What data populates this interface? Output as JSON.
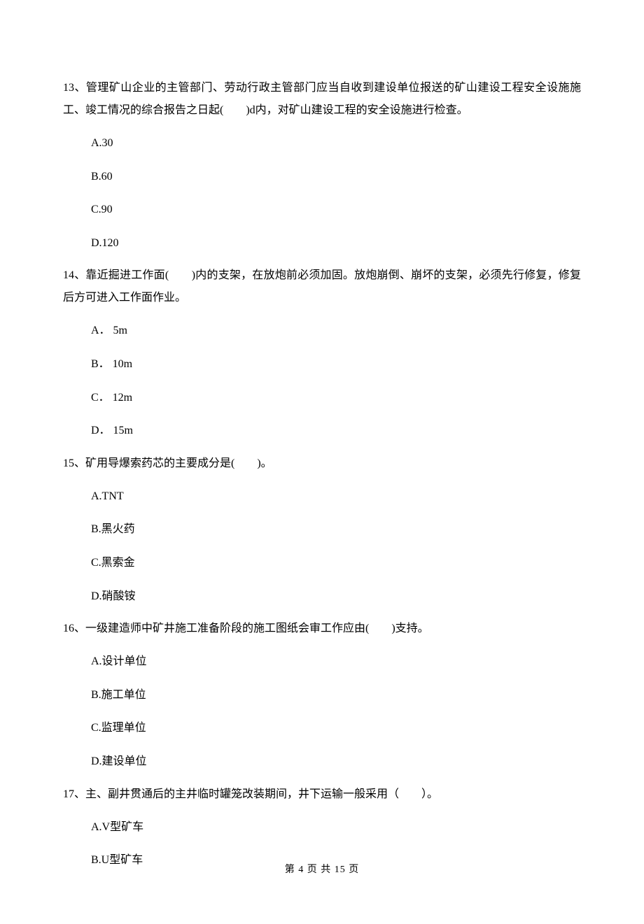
{
  "questions": [
    {
      "number": "13、",
      "text": "管理矿山企业的主管部门、劳动行政主管部门应当自收到建设单位报送的矿山建设工程安全设施施工、竣工情况的综合报告之日起(　　)d内，对矿山建设工程的安全设施进行检查。",
      "options": [
        "A.30",
        "B.60",
        "C.90",
        "D.120"
      ]
    },
    {
      "number": "14、",
      "text": "靠近掘进工作面(　　)内的支架，在放炮前必须加固。放炮崩倒、崩坏的支架，必须先行修复，修复后方可进入工作面作业。",
      "options": [
        "A． 5m",
        "B． 10m",
        "C． 12m",
        "D． 15m"
      ]
    },
    {
      "number": "15、",
      "text": "矿用导爆索药芯的主要成分是(　　)。",
      "options": [
        "A.TNT",
        "B.黑火药",
        "C.黑索金",
        "D.硝酸铵"
      ]
    },
    {
      "number": "16、",
      "text": "一级建造师中矿井施工准备阶段的施工图纸会审工作应由(　　)支持。",
      "options": [
        "A.设计单位",
        "B.施工单位",
        "C.监理单位",
        "D.建设单位"
      ]
    },
    {
      "number": "17、",
      "text": "主、副井贯通后的主井临时罐笼改装期间，井下运输一般采用（　　）。",
      "options": [
        "A.V型矿车",
        "B.U型矿车"
      ]
    }
  ],
  "footer": "第 4 页 共 15 页"
}
